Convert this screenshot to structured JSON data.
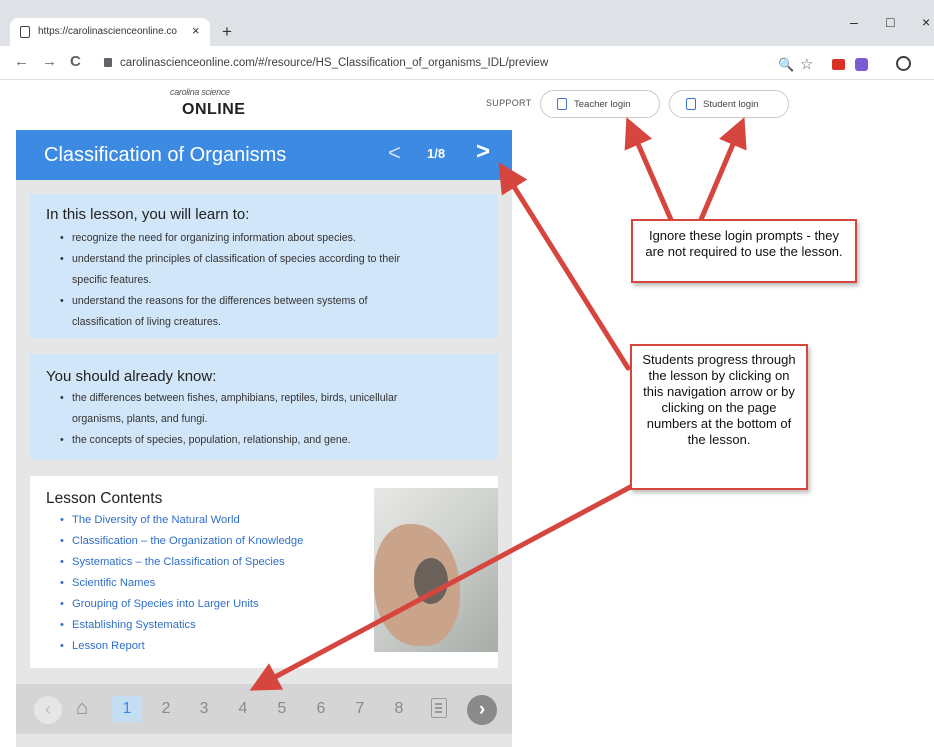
{
  "browser": {
    "tab_title": "https://carolinascienceonline.co",
    "new_tab": "+",
    "tab_close": "×",
    "minimize": "–",
    "maximize": "□",
    "close": "×",
    "back": "←",
    "forward": "→",
    "reload": "C",
    "url": "carolinascienceonline.com/#/resource/HS_Classification_of_organisms_IDL/preview",
    "zoom_icon": "🔍",
    "star_icon": "☆"
  },
  "site": {
    "logo_top": "carolina science",
    "logo_main": "ONLINE",
    "support": "SUPPORT",
    "teacher_login": "Teacher login",
    "student_login": "Student login"
  },
  "lesson": {
    "title": "Classification of Organisms",
    "prev": "<",
    "page": "1/8",
    "next": ">",
    "learn": {
      "heading": "In this lesson, you will learn to:",
      "items": [
        "recognize the need for organizing information about species.",
        "understand the principles of classification of species according to their",
        "specific features.",
        "understand the reasons for the differences between systems of",
        "classification of living creatures."
      ]
    },
    "know": {
      "heading": "You should already know:",
      "items": [
        "the differences between fishes, amphibians, reptiles, birds, unicellular",
        "organisms, plants, and fungi.",
        "the concepts of species, population, relationship, and gene."
      ]
    },
    "contents": {
      "heading": "Lesson Contents",
      "items": [
        "The Diversity of the Natural World",
        "Classification – the Organization of Knowledge",
        "Systematics – the Classification of Species",
        "Scientific Names",
        "Grouping of Species into Larger Units",
        "Establishing Systematics",
        "Lesson Report"
      ]
    },
    "pager": {
      "prev": "‹",
      "home": "⌂",
      "pages": [
        "1",
        "2",
        "3",
        "4",
        "5",
        "6",
        "7",
        "8"
      ],
      "active_page": "1",
      "next": "›"
    }
  },
  "callouts": {
    "login": "Ignore these login prompts - they are not required to use the lesson.",
    "nav": "Students progress through the lesson by clicking on this navigation arrow or by clicking on the page numbers at the bottom of the lesson."
  },
  "colors": {
    "header_blue": "#3d8ae3",
    "box_blue": "#d2e6fa",
    "arrow_red": "#d6463f"
  }
}
